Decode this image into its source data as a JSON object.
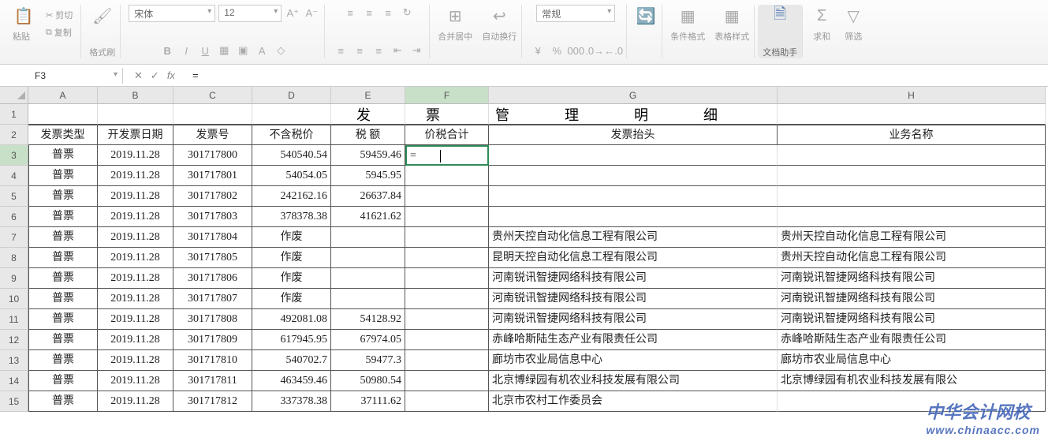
{
  "ribbon": {
    "paste": "粘贴",
    "cut": "剪切",
    "copy": "复制",
    "format_painter": "格式刷",
    "font_name": "宋体",
    "font_size": "12",
    "merge_center": "合并居中",
    "wrap_text": "自动换行",
    "number_format": "常规",
    "cond_format": "条件格式",
    "table_style": "表格样式",
    "doc_helper": "文档助手",
    "sum": "求和",
    "filter": "筛选"
  },
  "namebox": "F3",
  "formula": "=",
  "col_headers": [
    "A",
    "B",
    "C",
    "D",
    "E",
    "F",
    "G",
    "H"
  ],
  "row_headers": [
    "1",
    "2",
    "3",
    "4",
    "5",
    "6",
    "7",
    "8",
    "9",
    "10",
    "11",
    "12",
    "13",
    "14",
    "15"
  ],
  "title_chars": [
    "发",
    "票",
    "管",
    "理",
    "明",
    "细"
  ],
  "headers": {
    "A": "发票类型",
    "B": "开发票日期",
    "C": "发票号",
    "D": "不含税价",
    "E": "税 额",
    "F": "价税合计",
    "G": "发票抬头",
    "H": "业务名称"
  },
  "rows": [
    {
      "A": "普票",
      "B": "2019.11.28",
      "C": "301717800",
      "D": "540540.54",
      "E": "59459.46",
      "F": "=",
      "G": "",
      "H": ""
    },
    {
      "A": "普票",
      "B": "2019.11.28",
      "C": "301717801",
      "D": "54054.05",
      "E": "5945.95",
      "F": "",
      "G": "",
      "H": ""
    },
    {
      "A": "普票",
      "B": "2019.11.28",
      "C": "301717802",
      "D": "242162.16",
      "E": "26637.84",
      "F": "",
      "G": "",
      "H": ""
    },
    {
      "A": "普票",
      "B": "2019.11.28",
      "C": "301717803",
      "D": "378378.38",
      "E": "41621.62",
      "F": "",
      "G": "",
      "H": ""
    },
    {
      "A": "普票",
      "B": "2019.11.28",
      "C": "301717804",
      "D": "作废",
      "E": "",
      "F": "",
      "G": "贵州天控自动化信息工程有限公司",
      "H": "贵州天控自动化信息工程有限公司"
    },
    {
      "A": "普票",
      "B": "2019.11.28",
      "C": "301717805",
      "D": "作废",
      "E": "",
      "F": "",
      "G": "昆明天控自动化信息工程有限公司",
      "H": "贵州天控自动化信息工程有限公司"
    },
    {
      "A": "普票",
      "B": "2019.11.28",
      "C": "301717806",
      "D": "作废",
      "E": "",
      "F": "",
      "G": "河南锐讯智捷网络科技有限公司",
      "H": "河南锐讯智捷网络科技有限公司"
    },
    {
      "A": "普票",
      "B": "2019.11.28",
      "C": "301717807",
      "D": "作废",
      "E": "",
      "F": "",
      "G": "河南锐讯智捷网络科技有限公司",
      "H": "河南锐讯智捷网络科技有限公司"
    },
    {
      "A": "普票",
      "B": "2019.11.28",
      "C": "301717808",
      "D": "492081.08",
      "E": "54128.92",
      "F": "",
      "G": "河南锐讯智捷网络科技有限公司",
      "H": "河南锐讯智捷网络科技有限公司"
    },
    {
      "A": "普票",
      "B": "2019.11.28",
      "C": "301717809",
      "D": "617945.95",
      "E": "67974.05",
      "F": "",
      "G": "赤峰哈斯陆生态产业有限责任公司",
      "H": "赤峰哈斯陆生态产业有限责任公司"
    },
    {
      "A": "普票",
      "B": "2019.11.28",
      "C": "301717810",
      "D": "540702.7",
      "E": "59477.3",
      "F": "",
      "G": "廊坊市农业局信息中心",
      "H": "廊坊市农业局信息中心"
    },
    {
      "A": "普票",
      "B": "2019.11.28",
      "C": "301717811",
      "D": "463459.46",
      "E": "50980.54",
      "F": "",
      "G": "北京博绿园有机农业科技发展有限公司",
      "H": "北京博绿园有机农业科技发展有限公"
    },
    {
      "A": "普票",
      "B": "2019.11.28",
      "C": "301717812",
      "D": "337378.38",
      "E": "37111.62",
      "F": "",
      "G": "北京市农村工作委员会",
      "H": ""
    }
  ],
  "watermark": {
    "main": "中华会计网校",
    "sub": "www.chinaacc.com"
  }
}
